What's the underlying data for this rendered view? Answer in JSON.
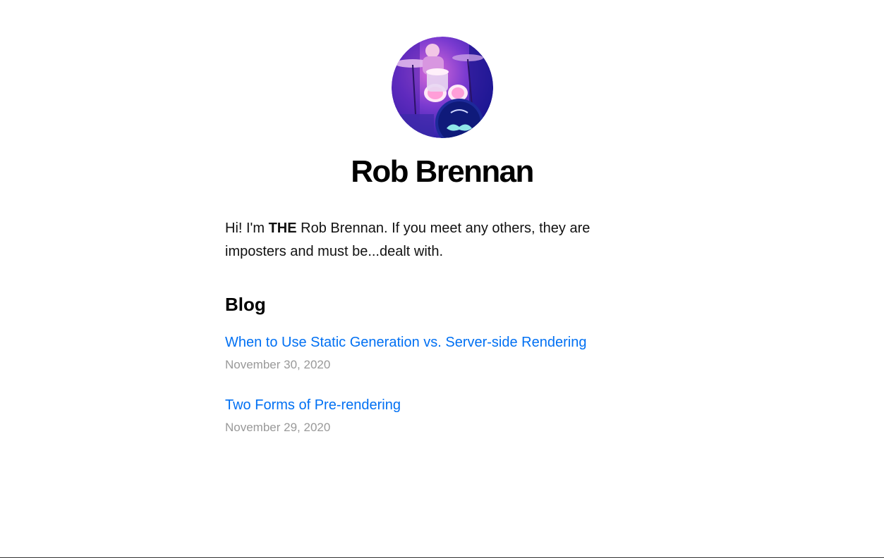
{
  "profile": {
    "name": "Rob Brennan",
    "avatar_icon": "drum-kit-photo"
  },
  "intro": {
    "before": "Hi! I'm ",
    "emphasis": "THE",
    "after": " Rob Brennan. If you meet any others, they are imposters and must be...dealt with."
  },
  "blog": {
    "heading": "Blog",
    "posts": [
      {
        "title": "When to Use Static Generation vs. Server-side Rendering",
        "date": "November 30, 2020"
      },
      {
        "title": "Two Forms of Pre-rendering",
        "date": "November 29, 2020"
      }
    ]
  },
  "colors": {
    "link": "#0070f3",
    "date": "#999999",
    "text": "#111111"
  }
}
